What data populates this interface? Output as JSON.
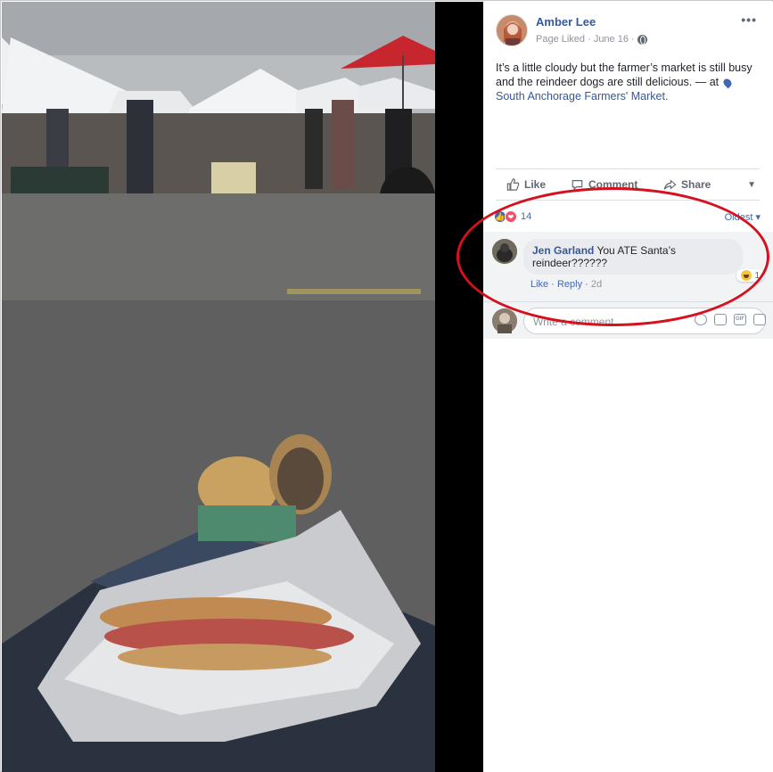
{
  "post": {
    "author": "Amber Lee",
    "meta_text": "Page Liked · June 16 ·",
    "more_label": "•••",
    "text": "It’s a little cloudy but the farmer’s market is still busy and the reindeer dogs are still delicious. — at",
    "location": "South Anchorage Farmers' Market.",
    "actions": {
      "like": "Like",
      "comment": "Comment",
      "share": "Share",
      "menu": "▼"
    },
    "reactions_count": "14",
    "sort_label": "Oldest ▾"
  },
  "comment": {
    "author": "Jen Garland",
    "text": "You ATE Santa’s reindeer??????",
    "reaction_count": "1",
    "like": "Like",
    "sep": " · ",
    "reply": "Reply",
    "time": "2d"
  },
  "composer": {
    "placeholder": "Write a comment...",
    "icons": [
      "emoji-icon",
      "camera-icon",
      "gif-icon",
      "sticker-icon"
    ],
    "gif_label": "GIF"
  },
  "colors": {
    "link": "#365899",
    "annotation": "#d6101c",
    "like_blue": "#4267b2"
  }
}
